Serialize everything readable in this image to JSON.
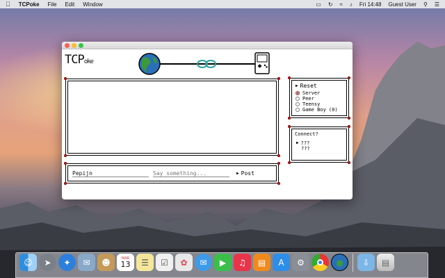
{
  "menubar": {
    "app_name": "TCPoke",
    "menus": [
      "File",
      "Edit",
      "Window"
    ],
    "clock": "Fri 14:48",
    "user": "Guest User"
  },
  "app": {
    "title": "TCP",
    "title_suffix": "oke",
    "chat": {
      "name_value": "Pepijn",
      "message_placeholder": "Say something...",
      "post_label": "Post"
    },
    "mode": {
      "reset_label": "Reset",
      "options": [
        "Server",
        "Peer",
        "Teensy",
        "Game Boy (0)"
      ],
      "selected": "Server"
    },
    "connect": {
      "heading": "Connect?",
      "items": [
        "???",
        "???"
      ]
    }
  },
  "dock": {
    "calendar_month": "MAR",
    "calendar_day": "13",
    "icons": [
      "finder-icon",
      "launchpad-icon",
      "safari-icon",
      "mail-icon",
      "contacts-icon",
      "calendar-icon",
      "notes-icon",
      "reminders-icon",
      "photos-icon",
      "messages-icon",
      "facetime-icon",
      "music-icon",
      "ibooks-icon",
      "appstore-icon",
      "preferences-icon",
      "chrome-icon",
      "tcpoke-icon",
      "downloads-icon",
      "trash-icon"
    ]
  }
}
